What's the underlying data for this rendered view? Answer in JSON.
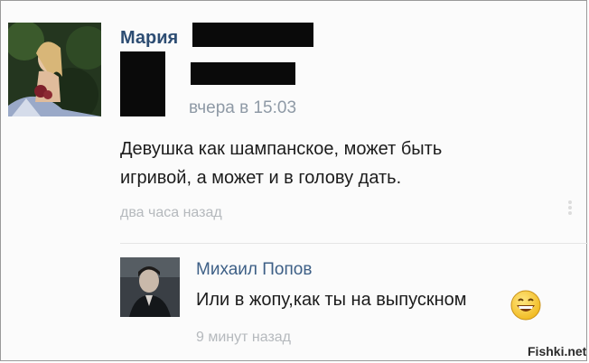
{
  "post": {
    "author": "Мария",
    "timestamp": "вчера в 15:03",
    "text_line1": "Девушка как шампанское, может быть",
    "text_line2": "игривой, а может и в голову дать.",
    "age": "два часа назад"
  },
  "comment": {
    "author": "Михаил Попов",
    "text": "Или в жопу,как ты на выпускном",
    "age": "9 минут назад",
    "emoji": "smiley-icon"
  },
  "watermark": "Fishki.net",
  "colors": {
    "name_link": "#2d4d73",
    "comment_link": "#3d5f86",
    "meta_text": "#8f9aa6",
    "redaction": "#0a0a0a"
  }
}
